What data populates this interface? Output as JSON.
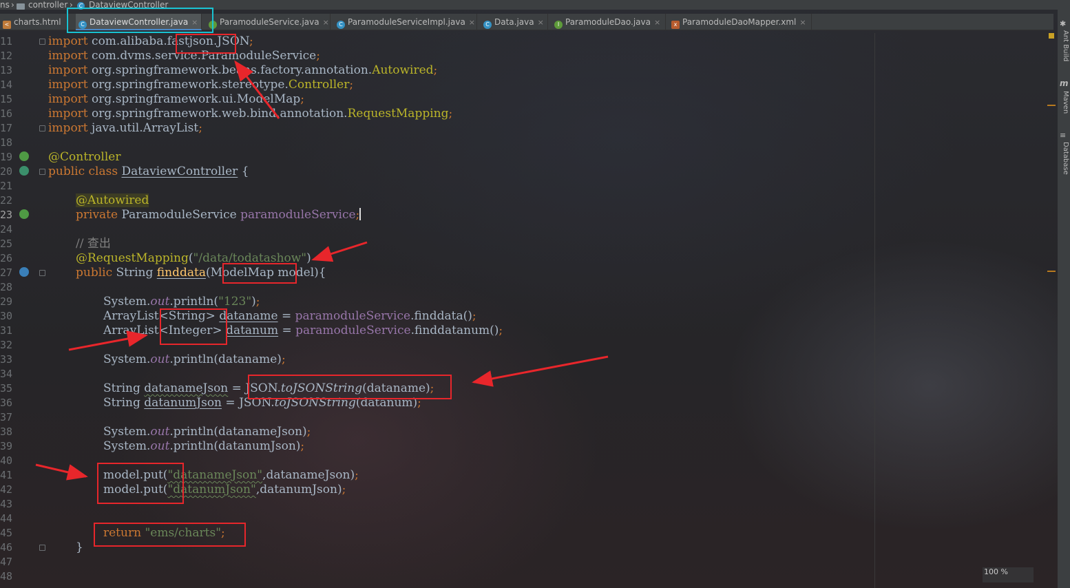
{
  "breadcrumb": {
    "prefix": "ns",
    "folder": "controller",
    "class": "DataviewController"
  },
  "tabs": [
    {
      "label": "charts.html",
      "icon": "html-file-icon",
      "active": false,
      "closable": false
    },
    {
      "label": "DataviewController.java",
      "icon": "class-icon",
      "active": true,
      "closable": true
    },
    {
      "label": "ParamoduleService.java",
      "icon": "interface-icon",
      "active": false,
      "closable": true
    },
    {
      "label": "ParamoduleServiceImpl.java",
      "icon": "class-icon",
      "active": false,
      "closable": true
    },
    {
      "label": "Data.java",
      "icon": "class-icon",
      "active": false,
      "closable": true
    },
    {
      "label": "ParamoduleDao.java",
      "icon": "interface-icon",
      "active": false,
      "closable": true
    },
    {
      "label": "ParamoduleDaoMapper.xml",
      "icon": "xml-file-icon",
      "active": false,
      "closable": true
    }
  ],
  "close_glyph": "×",
  "line_numbers": [
    "11",
    "12",
    "13",
    "14",
    "15",
    "16",
    "17",
    "18",
    "19",
    "20",
    "21",
    "22",
    "23",
    "24",
    "25",
    "26",
    "27",
    "28",
    "29",
    "30",
    "31",
    "32",
    "33",
    "34",
    "35",
    "36",
    "37",
    "38",
    "39",
    "40",
    "41",
    "42",
    "43",
    "44",
    "45",
    "46",
    "47",
    "48"
  ],
  "code": {
    "l11": {
      "kw": "import",
      "pkg": " com.alibaba.",
      "hl": "fastjson",
      "rest": ".JSON",
      "semi": ";"
    },
    "l12": {
      "kw": "import",
      "pkg": " com.dvms.service.ParamoduleService",
      "semi": ";"
    },
    "l13": {
      "kw": "import",
      "pkg": " org.springframework.beans.factory.annotation.",
      "ann": "Autowired",
      "semi": ";"
    },
    "l14": {
      "kw": "import",
      "pkg": " org.springframework.stereotype.",
      "ann": "Controller",
      "semi": ";"
    },
    "l15": {
      "kw": "import",
      "pkg": " org.springframework.ui.ModelMap",
      "semi": ";"
    },
    "l16": {
      "kw": "import",
      "pkg": " org.springframework.web.bind.annotation.",
      "ann": "RequestMapping",
      "semi": ";"
    },
    "l17": {
      "kw": "import",
      "pkg": " java.util.ArrayList",
      "semi": ";"
    },
    "l19": {
      "ann": "@Controller"
    },
    "l20": {
      "kw1": "public",
      "kw2": " class ",
      "name": "DataviewController",
      "rest": " {"
    },
    "l22": {
      "ann": "@Autowired"
    },
    "l23": {
      "kw": "private",
      "type": " ParamoduleService ",
      "field": "paramoduleService",
      "semi": ";"
    },
    "l25": {
      "comment": "// 查出"
    },
    "l26": {
      "ann": "@RequestMapping",
      "open": "(",
      "str": "\"/data/todatashow\"",
      "close": ")"
    },
    "l27": {
      "kw": "public",
      "type": " String ",
      "method": "finddata",
      "params": "(ModelMap model){"
    },
    "l29": {
      "obj": "System.",
      "sfield": "out",
      "call": ".println(",
      "str": "\"123\"",
      "end": ")",
      "semi": ";"
    },
    "l30": {
      "type": "ArrayList<String> ",
      "var": "dataname",
      "eq": " = ",
      "field": "paramoduleService",
      "call": ".finddata()",
      "semi": ";"
    },
    "l31": {
      "type": "ArrayList<Integer> ",
      "var": "datanum",
      "eq": " = ",
      "field": "paramoduleService",
      "call": ".finddatanum()",
      "semi": ";"
    },
    "l33": {
      "obj": "System.",
      "sfield": "out",
      "call": ".println(dataname)",
      "semi": ";"
    },
    "l35": {
      "type": "String ",
      "var": "datanameJson",
      "eq": " = JSON.",
      "smethod": "toJSONString",
      "arg": "(dataname)",
      "semi": ";"
    },
    "l36": {
      "type": "String ",
      "var": "datanumJson",
      "eq": " = JSON.",
      "smethod": "toJSONString",
      "arg": "(datanum)",
      "semi": ";"
    },
    "l38": {
      "obj": "System.",
      "sfield": "out",
      "call": ".println(datanameJson)",
      "semi": ";"
    },
    "l39": {
      "obj": "System.",
      "sfield": "out",
      "call": ".println(datanumJson)",
      "semi": ";"
    },
    "l41": {
      "call": "model.put(",
      "str": "\"datanameJson\"",
      "rest": ",datanameJson)",
      "semi": ";"
    },
    "l42": {
      "call": "model.put(",
      "str": "\"datanumJson\"",
      "rest": ",datanumJson)",
      "semi": ";"
    },
    "l45": {
      "kw": "return ",
      "str": "\"ems/charts\"",
      "semi": ";"
    },
    "l46": {
      "brace": "}"
    }
  },
  "right_tools": [
    "Ant Build",
    "Maven",
    "Database"
  ],
  "zoom": "100 %",
  "colors": {
    "annotation_box": "#e8262b",
    "active_tab_frame": "#19c3d3",
    "keyword": "#cc7832",
    "annotation": "#bbb529",
    "string": "#6a8759",
    "field": "#9876aa"
  }
}
